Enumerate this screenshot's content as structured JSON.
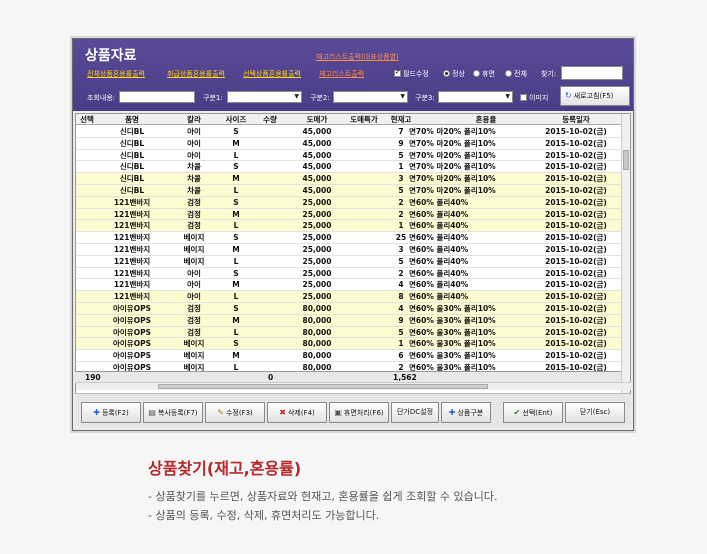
{
  "app": {
    "title": "상품자료",
    "links_top": [
      "재고리스트출력(대표상품별)"
    ],
    "links_row": [
      "전체상품혼용률출력",
      "취급상품혼용률출력",
      "선택상품혼용률출력",
      "재고리스트출력"
    ],
    "bold_label": "필드수정",
    "radio": [
      "정상",
      "휴면",
      "전체"
    ],
    "search_label": "찾기:",
    "query_label": "조회내용:",
    "filter_labels": [
      "구분1:",
      "구분2:",
      "구분3:"
    ],
    "image_label": "이미지",
    "refresh_label": "새로고침(F5)"
  },
  "table": {
    "headers": [
      "선택",
      "품명",
      "칼라",
      "사이즈",
      "수량",
      "도매가",
      "도매특가",
      "현재고",
      "혼용율",
      "등록일자"
    ],
    "rows": [
      [
        "",
        "신디BL",
        "아이",
        "S",
        "",
        "45,000",
        "",
        "7",
        "면70% 마20% 폴리10%",
        "2015-10-02(금)"
      ],
      [
        "",
        "신디BL",
        "아이",
        "M",
        "",
        "45,000",
        "",
        "9",
        "면70% 마20% 폴리10%",
        "2015-10-02(금)"
      ],
      [
        "",
        "신디BL",
        "아이",
        "L",
        "",
        "45,000",
        "",
        "5",
        "면70% 마20% 폴리10%",
        "2015-10-02(금)"
      ],
      [
        "",
        "신디BL",
        "차콜",
        "S",
        "",
        "45,000",
        "",
        "1",
        "면70% 마20% 폴리10%",
        "2015-10-02(금)"
      ],
      [
        "",
        "신디BL",
        "차콜",
        "M",
        "",
        "45,000",
        "",
        "3",
        "면70% 마20% 폴리10%",
        "2015-10-02(금)"
      ],
      [
        "",
        "신디BL",
        "차콜",
        "L",
        "",
        "45,000",
        "",
        "5",
        "면70% 마20% 폴리10%",
        "2015-10-02(금)"
      ],
      [
        "",
        "121밴바지",
        "검정",
        "S",
        "",
        "25,000",
        "",
        "2",
        "면60% 폴리40%",
        "2015-10-02(금)"
      ],
      [
        "",
        "121밴바지",
        "검정",
        "M",
        "",
        "25,000",
        "",
        "2",
        "면60% 폴리40%",
        "2015-10-02(금)"
      ],
      [
        "",
        "121밴바지",
        "검정",
        "L",
        "",
        "25,000",
        "",
        "1",
        "면60% 폴리40%",
        "2015-10-02(금)"
      ],
      [
        "",
        "121밴바지",
        "베이지",
        "S",
        "",
        "25,000",
        "",
        "25",
        "면60% 폴리40%",
        "2015-10-02(금)"
      ],
      [
        "",
        "121밴바지",
        "베이지",
        "M",
        "",
        "25,000",
        "",
        "3",
        "면60% 폴리40%",
        "2015-10-02(금)"
      ],
      [
        "",
        "121밴바지",
        "베이지",
        "L",
        "",
        "25,000",
        "",
        "5",
        "면60% 폴리40%",
        "2015-10-02(금)"
      ],
      [
        "",
        "121밴바지",
        "아이",
        "S",
        "",
        "25,000",
        "",
        "2",
        "면60% 폴리40%",
        "2015-10-02(금)"
      ],
      [
        "",
        "121밴바지",
        "아이",
        "M",
        "",
        "25,000",
        "",
        "4",
        "면60% 폴리40%",
        "2015-10-02(금)"
      ],
      [
        "",
        "121밴바지",
        "아이",
        "L",
        "",
        "25,000",
        "",
        "8",
        "면60% 폴리40%",
        "2015-10-02(금)"
      ],
      [
        "",
        "아이유OPS",
        "검정",
        "S",
        "",
        "80,000",
        "",
        "4",
        "면60% 울30% 폴리10%",
        "2015-10-02(금)"
      ],
      [
        "",
        "아이유OPS",
        "검정",
        "M",
        "",
        "80,000",
        "",
        "9",
        "면60% 울30% 폴리10%",
        "2015-10-02(금)"
      ],
      [
        "",
        "아이유OPS",
        "검정",
        "L",
        "",
        "80,000",
        "",
        "5",
        "면60% 울30% 폴리10%",
        "2015-10-02(금)"
      ],
      [
        "",
        "아이유OPS",
        "베이지",
        "S",
        "",
        "80,000",
        "",
        "1",
        "면60% 울30% 폴리10%",
        "2015-10-02(금)"
      ],
      [
        "",
        "아이유OPS",
        "베이지",
        "M",
        "",
        "80,000",
        "",
        "6",
        "면60% 울30% 폴리10%",
        "2015-10-02(금)"
      ],
      [
        "",
        "아이유OPS",
        "베이지",
        "L",
        "",
        "80,000",
        "",
        "2",
        "면60% 울30% 폴리10%",
        "2015-10-02(금)"
      ]
    ],
    "highlight": [
      false,
      false,
      false,
      false,
      true,
      true,
      true,
      true,
      true,
      false,
      false,
      false,
      false,
      false,
      true,
      true,
      true,
      true,
      true,
      false,
      false
    ],
    "summary": {
      "count": "190",
      "qty": "0",
      "stock": "1,562"
    }
  },
  "buttons": [
    "등록(F2)",
    "복사등록(F7)",
    "수정(F3)",
    "삭제(F4)",
    "휴면처리(F6)",
    "단가DC설정",
    "상품구분",
    "선택(Ent)",
    "닫기(Esc)"
  ],
  "caption": {
    "title": "상품찾기(재고,혼용률)",
    "lines": [
      "- 상품찾기를 누르면, 상품자료와 현재고, 혼용률을 쉽게 조회할 수 있습니다.",
      "- 상품의 등록, 수정, 삭제, 휴면처리도 가능합니다."
    ]
  },
  "colors": {
    "header": "#4a3c86",
    "link": "#ffd200",
    "highlight": "#fffbd0",
    "caption": "#b8282a"
  }
}
